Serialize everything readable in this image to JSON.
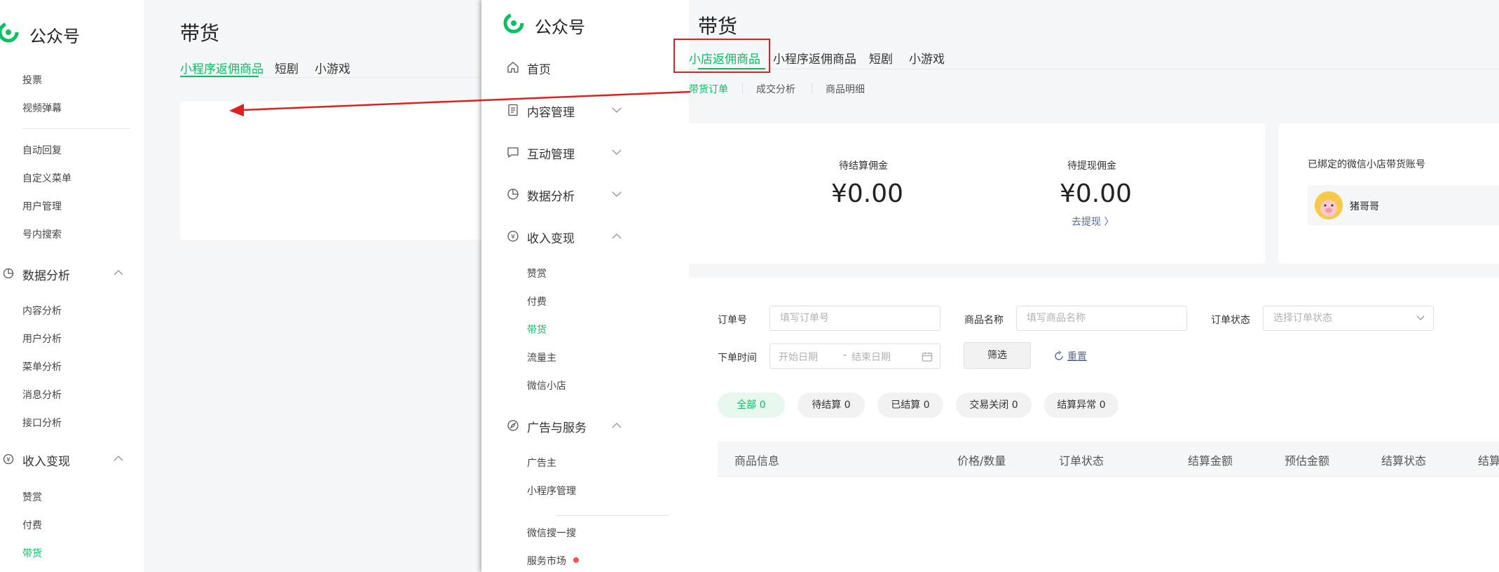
{
  "back_window": {
    "logo_text": "公众号",
    "title": "带货",
    "tabs": [
      "小程序返佣商品",
      "短剧",
      "小游戏"
    ],
    "sidebar_items_top": [
      "投票",
      "视频弹幕"
    ],
    "sidebar_items_mid": [
      "自动回复",
      "自定义菜单",
      "用户管理",
      "号内搜索"
    ],
    "section_data": "数据分析",
    "data_items": [
      "内容分析",
      "用户分析",
      "菜单分析",
      "消息分析",
      "接口分析"
    ],
    "section_income": "收入变现",
    "income_items": [
      "赞赏",
      "付费",
      "带货"
    ]
  },
  "front_window": {
    "logo_text": "公众号",
    "nav": {
      "home": "首页",
      "content": "内容管理",
      "interaction": "互动管理",
      "data": "数据分析",
      "income": "收入变现",
      "ads": "广告与服务"
    },
    "income_sub": [
      "赞赏",
      "付费",
      "带货",
      "流量主",
      "微信小店"
    ],
    "ads_sub": [
      "广告主",
      "小程序管理"
    ],
    "other_sub": [
      "微信搜一搜",
      "服务市场"
    ],
    "title": "带货",
    "tabs": [
      "小店返佣商品",
      "小程序返佣商品",
      "短剧",
      "小游戏"
    ],
    "sub_tabs": [
      "带货订单",
      "成交分析",
      "商品明细"
    ],
    "stats": {
      "pending_label": "待结算佣金",
      "pending_value": "¥0.00",
      "withdraw_label": "待提现佣金",
      "withdraw_value": "¥0.00",
      "withdraw_link": "去提现 〉"
    },
    "account": {
      "title": "已绑定的微信小店带货账号",
      "name": "猪哥哥"
    },
    "filters": {
      "order_no_label": "订单号",
      "order_no_placeholder": "填写订单号",
      "product_label": "商品名称",
      "product_placeholder": "填写商品名称",
      "status_label": "订单状态",
      "status_placeholder": "选择订单状态",
      "time_label": "下单时间",
      "start_placeholder": "开始日期",
      "range_dash": "-",
      "end_placeholder": "结束日期",
      "filter_button": "筛选",
      "reset": "重置"
    },
    "status_pills": [
      "全部 0",
      "待结算 0",
      "已结算 0",
      "交易关闭 0",
      "结算异常 0"
    ],
    "table_headers": [
      "商品信息",
      "价格/数量",
      "订单状态",
      "结算金额",
      "预估金额",
      "结算状态",
      "结算"
    ]
  },
  "colors": {
    "brand_green": "#07c160",
    "link_blue": "#576b95",
    "annotation_red": "#e02020"
  }
}
